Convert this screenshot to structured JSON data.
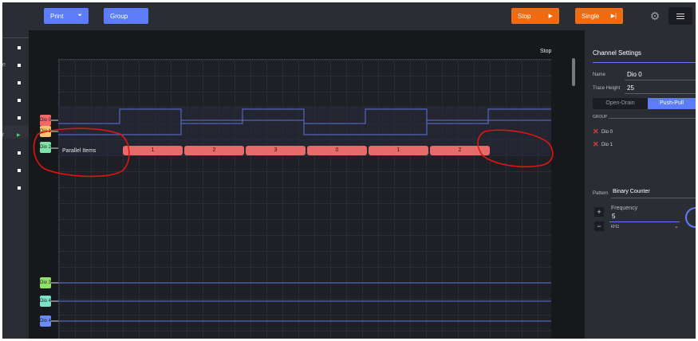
{
  "toolbar": {
    "print_label": "Print",
    "group_label": "Group",
    "stop_label": "Stop",
    "single_label": "Single"
  },
  "icons": {
    "print": "chevron-circle-down-icon",
    "stop": "play-icon",
    "single": "step-icon",
    "settings": "gear-icon",
    "menu": "hamburger-icon"
  },
  "colors": {
    "accent": "#5c7cfa",
    "run": "#f06a10",
    "parallel_segment": "#e86a6a",
    "annotation": "#e01515",
    "trace": "#5c72e0"
  },
  "leftstrip": {
    "frag_top": "e",
    "frag_active": "r"
  },
  "plot": {
    "status": "Stop",
    "parallel_label": "Parallel Items",
    "segments": [
      "1",
      "2",
      "3",
      "0",
      "1",
      "2"
    ]
  },
  "channels": [
    {
      "label": "Dio 0",
      "color": "#f06a6a"
    },
    {
      "label": "Dio 1",
      "color": "#f7c36b"
    },
    {
      "label": "Dio 2",
      "color": "#7fe3a8"
    },
    {
      "label": "Dio 3",
      "color": "#93e06e"
    },
    {
      "label": "Dio 4",
      "color": "#7ee0c8"
    },
    {
      "label": "Dio 4",
      "color": "#6a8cf0"
    }
  ],
  "panel": {
    "title": "Channel Settings",
    "name_label": "Name",
    "name_value": "Dio 0",
    "trace_height_label": "Trace Height",
    "trace_height_value": "25",
    "drive_options": [
      "Open-Drain",
      "Push-Pull"
    ],
    "drive_selected": "Push-Pull",
    "group_label": "GROUP",
    "group_items": [
      "Dio 0",
      "Dio 1"
    ],
    "pattern_label": "Pattern",
    "pattern_value": "Binary Counter",
    "frequency_label": "Frequency",
    "frequency_value": "5",
    "frequency_unit": "kHz",
    "plus": "+",
    "minus": "−"
  }
}
